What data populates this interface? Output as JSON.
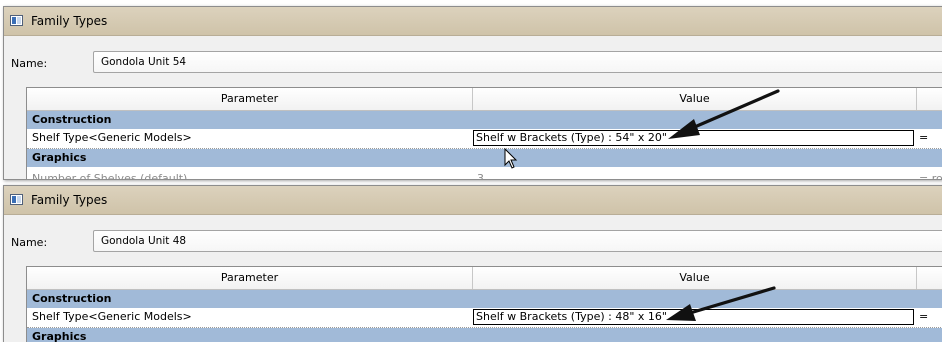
{
  "panels": [
    {
      "title": "Family Types",
      "name_label": "Name:",
      "name_value": "Gondola Unit 54",
      "columns": {
        "parameter": "Parameter",
        "value": "Value"
      },
      "groups": {
        "construction": "Construction",
        "graphics": "Graphics"
      },
      "shelf_row": {
        "parameter": "Shelf Type<Generic Models>",
        "value": "Shelf w Brackets (Type) : 54\" x 20\"",
        "formula": "="
      },
      "shelves_row": {
        "parameter": "Number of Shelves (default)",
        "value": "3",
        "formula": "= rou"
      }
    },
    {
      "title": "Family Types",
      "name_label": "Name:",
      "name_value": "Gondola Unit 48",
      "columns": {
        "parameter": "Parameter",
        "value": "Value"
      },
      "groups": {
        "construction": "Construction",
        "graphics": "Graphics"
      },
      "shelf_row": {
        "parameter": "Shelf Type<Generic Models>",
        "value": "Shelf w Brackets (Type) : 48\" x 16\"",
        "formula": "="
      }
    }
  ],
  "colors": {
    "titlebar": "#d8cdb5",
    "group_row": "#a1bad8",
    "arrow": "#111111"
  }
}
